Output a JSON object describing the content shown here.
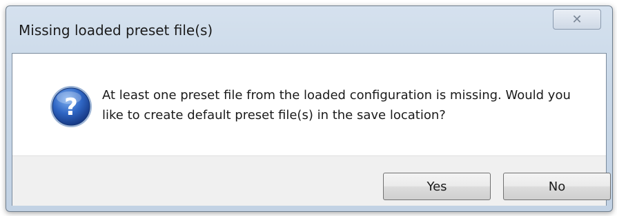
{
  "dialog": {
    "title": "Missing loaded preset file(s)",
    "close_glyph": "✕",
    "message": "At least one preset file from the loaded configuration is missing. Would you like to create default preset file(s) in the save location?",
    "icon": "question-icon",
    "buttons": {
      "yes_label": "Yes",
      "no_label": "No"
    }
  },
  "colors": {
    "frame": "#c9d8e8",
    "icon_blue": "#2a5db0",
    "button_area": "#f0f0f0"
  }
}
